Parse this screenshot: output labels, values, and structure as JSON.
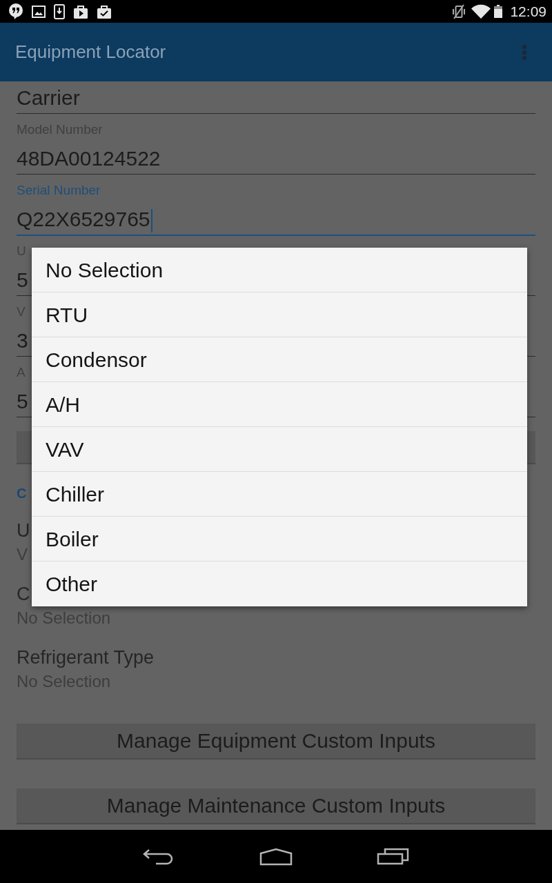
{
  "status_bar": {
    "time": "12:09"
  },
  "app_bar": {
    "title": "Equipment Locator"
  },
  "form": [
    {
      "kind": "input",
      "value": "Carrier",
      "focused": false
    },
    {
      "kind": "input",
      "label": "Model Number",
      "value": "48DA00124522",
      "focused": false
    },
    {
      "kind": "input",
      "label": "Serial Number",
      "value": "Q22X6529765",
      "focused": true
    },
    {
      "kind": "input",
      "label": "U",
      "value": "5",
      "focused": false
    },
    {
      "kind": "input",
      "label": "V",
      "value": "3",
      "focused": false
    },
    {
      "kind": "input",
      "label": "A",
      "value": "5",
      "focused": false
    },
    {
      "kind": "button"
    },
    {
      "kind": "section",
      "title": "C"
    },
    {
      "kind": "picker",
      "label": "U",
      "value": "V"
    },
    {
      "kind": "picker",
      "label": "C",
      "value": "No Selection"
    },
    {
      "kind": "picker",
      "label": "Refrigerant Type",
      "value": "No Selection"
    },
    {
      "kind": "button",
      "label": "Manage Equipment Custom Inputs"
    },
    {
      "kind": "button",
      "label": "Manage Maintenance Custom Inputs"
    }
  ],
  "dialog": {
    "options": [
      "No Selection",
      "RTU",
      "Condensor",
      "A/H",
      "VAV",
      "Chiller",
      "Boiler",
      "Other"
    ]
  }
}
